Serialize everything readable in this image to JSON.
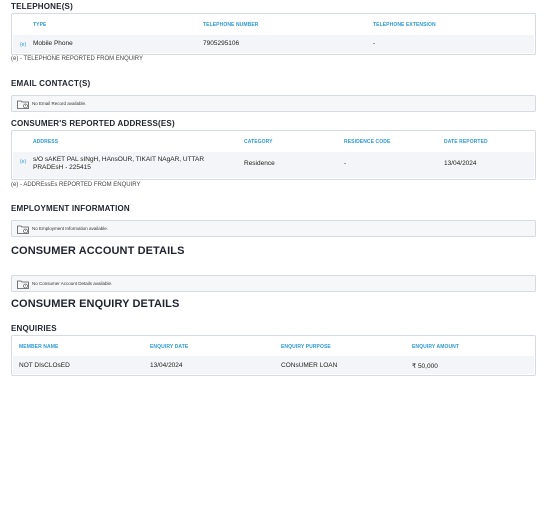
{
  "telephones": {
    "title": "TELEPHONE(S)",
    "headers": [
      "TYPE",
      "TELEPHONE NUMBER",
      "TELEPHONE EXTENSION"
    ],
    "rows": [
      {
        "marker": "(e)",
        "type": "Mobile Phone",
        "number": "7905295106",
        "extension": "-"
      }
    ],
    "note": "(e) - TELEPHONE REPORTED FROM ENQUIRY"
  },
  "email": {
    "title": "EMAIL CONTACT(S)",
    "empty": "No Email Record available."
  },
  "addresses": {
    "title": "CONSUMER'S REPORTED ADDRESS(ES)",
    "headers": [
      "ADDRESS",
      "CATEGORY",
      "RESIDENCE CODE",
      "DATE REPORTED"
    ],
    "rows": [
      {
        "marker": "(e)",
        "address_line1": "s/O sAKET PAL sINgH, HAnsOUR, TIKAIT NAgAR, UTTAR",
        "address_line2": "PRADEsH - 225415",
        "category": "Residence",
        "residence_code": "-",
        "date_reported": "13/04/2024"
      }
    ],
    "note": "(e) - ADDREssEs REPORTED FROM ENQUIRY"
  },
  "employment": {
    "title": "EMPLOYMENT INFORMATION",
    "empty": "No Employment Information available."
  },
  "accounts": {
    "title": "CONSUMER ACCOUNT DETAILS",
    "empty": "No Consumer Account Details available."
  },
  "enquiry_details": {
    "title": "CONSUMER ENQUIRY DETAILS"
  },
  "enquiries": {
    "title": "ENQUIRIES",
    "headers": [
      "MEMBER NAME",
      "ENQUIRY DATE",
      "ENQUIRY PURPOSE",
      "ENQUIRY AMOUNT"
    ],
    "rows": [
      {
        "member": "NOT DIsCLOsED",
        "date": "13/04/2024",
        "purpose": "CONsUMER LOAN",
        "amount": "₹ 50,000"
      }
    ]
  },
  "colors": {
    "header_text": "#2c9ad6",
    "border": "#d6dbe3",
    "band": "#f4f5f8"
  },
  "icons": {
    "empty_state": "folder-icon"
  }
}
